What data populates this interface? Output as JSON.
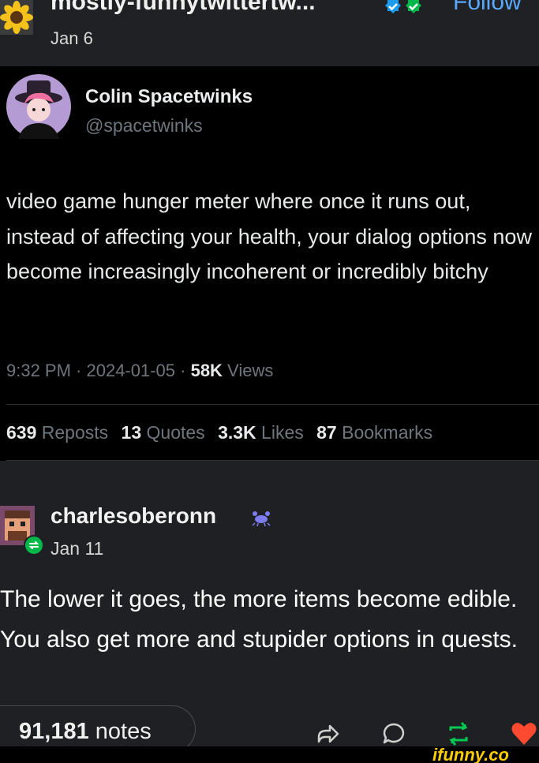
{
  "post": {
    "author": "mostly-funnytwittertw...",
    "follow_label": "Follow",
    "date": "Jan 6"
  },
  "tweet": {
    "display_name": "Colin Spacetwinks",
    "handle": "@spacetwinks",
    "text": "video game hunger meter where once it runs out, instead of affecting your health, your dialog options now become increasingly incoherent or incredibly bitchy",
    "time": "9:32 PM · 2024-01-05 · ",
    "views_count": "58K",
    "views_label": " Views",
    "stats": [
      {
        "count": "639",
        "label": "Reposts"
      },
      {
        "count": "13",
        "label": "Quotes"
      },
      {
        "count": "3.3K",
        "label": "Likes"
      },
      {
        "count": "87",
        "label": "Bookmarks"
      }
    ]
  },
  "reblog": {
    "username": "charlesoberonn",
    "date": "Jan 11",
    "text": "The lower it goes, the more items become edible. You also get more and stupider options in quests."
  },
  "footer": {
    "notes_count": "91,181",
    "notes_label": " notes",
    "watermark": "ifunny.co"
  },
  "colors": {
    "follow": "#5aa9ff",
    "verified": "#1d9bf0",
    "reblog_green": "#00b84a",
    "like_red": "#ff4930"
  },
  "icons": [
    "sunflower-avatar-icon",
    "verified-badge-icon",
    "share-icon",
    "reply-icon",
    "reblog-icon",
    "heart-icon"
  ]
}
